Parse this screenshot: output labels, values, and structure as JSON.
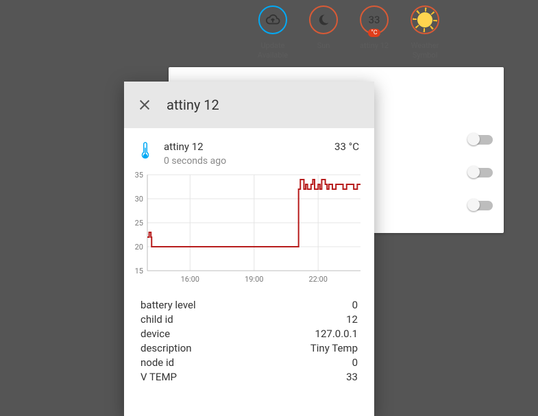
{
  "badges": [
    {
      "label": "Update\nAvailable",
      "kind": "cloud",
      "blue": true
    },
    {
      "label": "Sun",
      "kind": "moon",
      "blue": false
    },
    {
      "label": "attiny 12",
      "kind": "value",
      "value": "33",
      "pill": "°C",
      "blue": false
    },
    {
      "label": "Weather\nSymbol",
      "kind": "sun",
      "blue": false
    }
  ],
  "toggles": [
    {
      "on": false
    },
    {
      "on": false
    },
    {
      "on": false
    }
  ],
  "dialog": {
    "title": "attiny 12",
    "sensor": {
      "name": "attiny 12",
      "age": "0 seconds ago",
      "value": "33 °C"
    },
    "attributes": [
      {
        "key": "battery level",
        "value": "0"
      },
      {
        "key": "child id",
        "value": "12"
      },
      {
        "key": "device",
        "value": "127.0.0.1"
      },
      {
        "key": "description",
        "value": "Tiny Temp"
      },
      {
        "key": "node id",
        "value": "0"
      },
      {
        "key": "V TEMP",
        "value": "33"
      }
    ]
  },
  "chart_data": {
    "type": "line",
    "title": "",
    "xlabel": "",
    "ylabel": "",
    "ylim": [
      15,
      35
    ],
    "y_ticks": [
      15,
      20,
      25,
      30,
      35
    ],
    "x_ticks": [
      "16:00",
      "19:00",
      "22:00"
    ],
    "x": [
      "14:00",
      "14:05",
      "14:10",
      "14:12",
      "21:00",
      "21:05",
      "21:10",
      "21:20",
      "21:25",
      "21:30",
      "21:40",
      "21:45",
      "21:50",
      "22:00",
      "22:05",
      "22:10",
      "22:20",
      "22:25",
      "22:30",
      "22:40",
      "22:50",
      "23:00",
      "23:10",
      "23:20",
      "23:30",
      "23:40",
      "23:50",
      "23:59"
    ],
    "values": [
      22,
      23,
      22,
      20,
      20,
      32,
      34,
      32,
      33,
      32,
      33,
      34,
      32,
      33,
      32,
      34,
      33,
      32,
      33,
      32,
      33,
      33,
      32,
      33,
      33,
      32,
      33,
      33
    ]
  }
}
